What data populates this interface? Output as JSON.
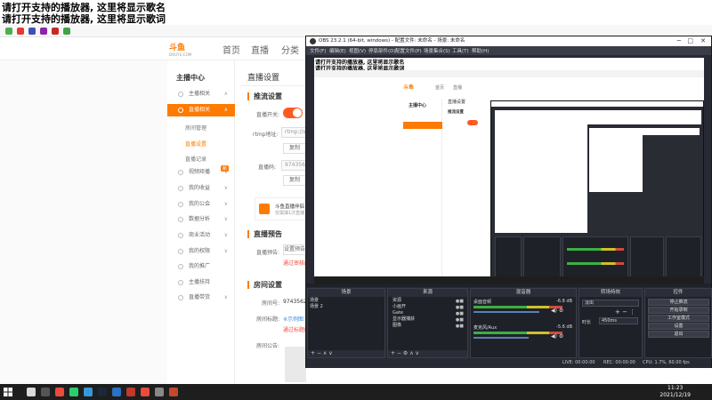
{
  "overlay": {
    "line1": "请打开支持的播放器, 这里将显示歌名",
    "line2": "请打开支持的播放器, 这里将显示歌词"
  },
  "browser": {
    "bookmarks_colors": [
      "#4caf50",
      "#e53935",
      "#3f51b5",
      "#8e24aa",
      "#c62828",
      "#43a047"
    ]
  },
  "site": {
    "logo": "斗鱼",
    "logo_sub": "DOUYU.COM",
    "nav": [
      "首页",
      "直播",
      "分类"
    ]
  },
  "menu": {
    "title": "主播中心",
    "items": [
      {
        "label": "主播相关",
        "chev": "∧"
      },
      {
        "label": "直播相关",
        "chev": "∧",
        "active": true
      },
      {
        "label": "视频矩播",
        "chev": "∨",
        "badge": "新"
      },
      {
        "label": "我的收益",
        "chev": "∨"
      },
      {
        "label": "我的公会",
        "chev": "∨"
      },
      {
        "label": "数据分析",
        "chev": "∨"
      },
      {
        "label": "商业活动",
        "chev": "∨"
      },
      {
        "label": "我的权限",
        "chev": "∨"
      },
      {
        "label": "我的推广",
        "chev": ""
      },
      {
        "label": "主播扶持",
        "chev": ""
      },
      {
        "label": "直播带货",
        "chev": "∨"
      }
    ],
    "subitems": [
      "房间管理",
      "直播设置",
      "直播记录"
    ],
    "active_sub": "直播设置"
  },
  "content": {
    "page_title": "直播设置",
    "stream": {
      "title": "推流设置",
      "switch_label": "直播开关:",
      "rtmp_label": "rtmp地址:",
      "rtmp_value": "rtmp://s",
      "copy": "复制",
      "code_label": "直播码:",
      "code_value": "9743562",
      "promo_line1": "斗鱼直播伴侣",
      "promo_line2": "仅需填1次直播"
    },
    "notice": {
      "title": "直播预告",
      "label": "直播预告:",
      "value": "设置预告",
      "link": "通过审核的预"
    },
    "room": {
      "title": "房间设置",
      "num_label": "房间号:",
      "num_value": "9743562",
      "name_label": "房间标题:",
      "name_value": "※示例图",
      "name_link": "通过标题的审",
      "notice_label": "房间公告:"
    }
  },
  "obs": {
    "title": "OBS 23.2.1 (64-bit, windows) - 配置文件: 未命名 - 场景: 未命名",
    "menu": [
      "文件(F)",
      "编辑(E)",
      "视图(V)",
      "停靠部件(D)",
      "配置文件(P)",
      "场景集合(S)",
      "工具(T)",
      "帮助(H)"
    ],
    "docks": {
      "scenes": {
        "title": "场景",
        "items": [
          "场景",
          "场景 2"
        ]
      },
      "sources": {
        "title": "来源",
        "items": [
          "资源",
          "小画开",
          "Gate",
          "显示器捕获",
          "图像"
        ]
      },
      "mixer": {
        "title": "混音器",
        "tracks": [
          {
            "name": "桌面音频",
            "db": "-6.8 dB"
          },
          {
            "name": "麦克风/Aux",
            "db": "-5.6 dB"
          }
        ]
      },
      "transitions": {
        "title": "转场特效",
        "mode": "淡出",
        "duration_label": "时长",
        "duration": "450ms"
      },
      "controls": {
        "title": "控件",
        "buttons": [
          "停止推流",
          "开始录制",
          "工作室模式",
          "设置",
          "退出"
        ]
      }
    },
    "status": {
      "live": "LIVE: 00:00:00",
      "rec": "REC: 00:00:00",
      "cpu": "CPU: 1.7%, 60.00 fps"
    }
  },
  "taskbar": {
    "time": "11:23",
    "date": "2021/12/19",
    "icon_colors": [
      "#d9d9d9",
      "#555",
      "#e74c3c",
      "#2ecc71",
      "#3498db",
      "#1b2838",
      "#2a72c4",
      "#c0392b",
      "#e74c3c",
      "#888",
      "#c24a2b"
    ]
  }
}
